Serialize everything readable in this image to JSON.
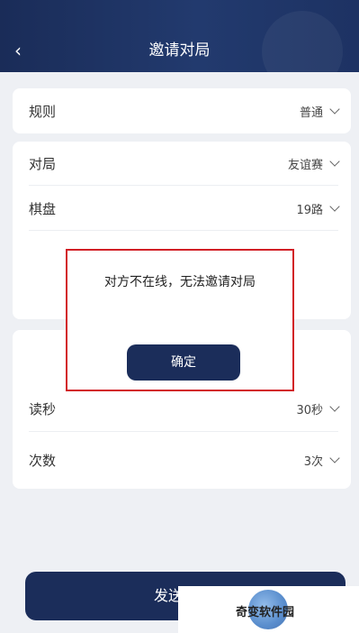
{
  "header": {
    "title": "邀请对局",
    "back_icon": "‹"
  },
  "rules": {
    "label": "规则",
    "value": "普通"
  },
  "settings": [
    {
      "label": "对局",
      "value": "友谊赛"
    },
    {
      "label": "棋盘",
      "value": "19路"
    }
  ],
  "time": [
    {
      "label": "读秒",
      "value": "30秒"
    },
    {
      "label": "次数",
      "value": "3次"
    }
  ],
  "dialog": {
    "message": "对方不在线，无法邀请对局",
    "confirm": "确定"
  },
  "send_button": {
    "label": "发送"
  },
  "watermark": {
    "text": "奇变软件园"
  },
  "colors": {
    "header": "#1d3263",
    "button": "#1b2d5a",
    "highlight": "#d21f26"
  }
}
